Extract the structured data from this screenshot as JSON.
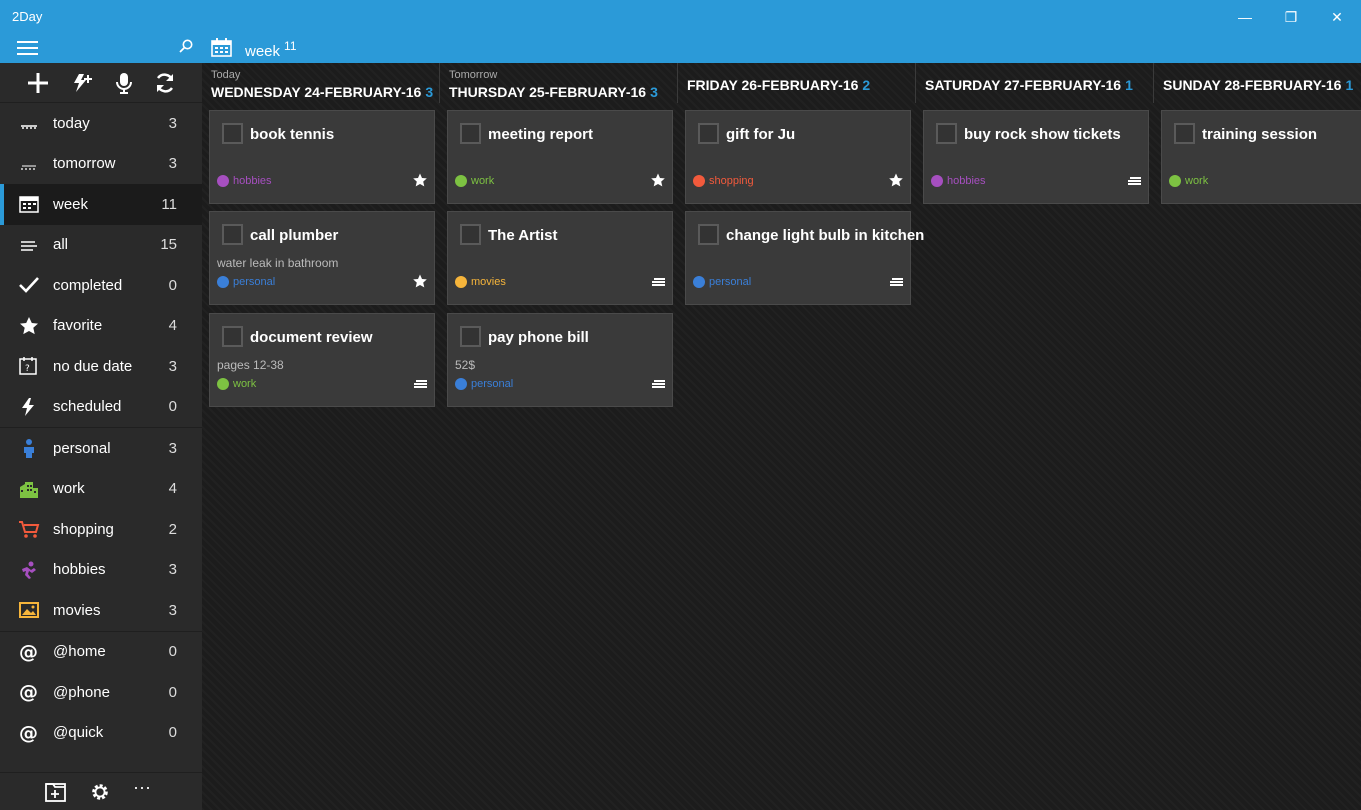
{
  "app_title": "2Day",
  "header": {
    "title": "week",
    "count": "11"
  },
  "window_controls": {
    "minimize": "—",
    "maximize": "❐",
    "close": "✕"
  },
  "colors": {
    "accent": "#2b9ad8",
    "hobbies": "#a64fc0",
    "work": "#7dc242",
    "shopping": "#f25a3c",
    "personal": "#3a7fd8",
    "movies": "#f6b53b"
  },
  "sidebar": {
    "items": [
      {
        "label": "today",
        "count": "3",
        "icon": "today-icon"
      },
      {
        "label": "tomorrow",
        "count": "3",
        "icon": "tomorrow-icon"
      },
      {
        "label": "week",
        "count": "11",
        "icon": "calendar-icon"
      },
      {
        "label": "all",
        "count": "15",
        "icon": "list-icon"
      },
      {
        "label": "completed",
        "count": "0",
        "icon": "check-icon"
      },
      {
        "label": "favorite",
        "count": "4",
        "icon": "star-icon"
      },
      {
        "label": "no due date",
        "count": "3",
        "icon": "no-date-icon"
      },
      {
        "label": "scheduled",
        "count": "0",
        "icon": "lightning-icon"
      },
      {
        "label": "personal",
        "count": "3",
        "icon": "person-icon"
      },
      {
        "label": "work",
        "count": "4",
        "icon": "building-icon"
      },
      {
        "label": "shopping",
        "count": "2",
        "icon": "cart-icon"
      },
      {
        "label": "hobbies",
        "count": "3",
        "icon": "hobbies-icon"
      },
      {
        "label": "movies",
        "count": "3",
        "icon": "picture-icon"
      },
      {
        "label": "@home",
        "count": "0",
        "icon": "at-icon"
      },
      {
        "label": "@phone",
        "count": "0",
        "icon": "at-icon"
      },
      {
        "label": "@quick",
        "count": "0",
        "icon": "at-icon"
      }
    ],
    "bottom_more": "···"
  },
  "days": [
    {
      "sub": "Today",
      "title": "WEDNESDAY 24-FEBRUARY-16",
      "count": "3"
    },
    {
      "sub": "Tomorrow",
      "title": "THURSDAY 25-FEBRUARY-16",
      "count": "3"
    },
    {
      "sub": "",
      "title": "FRIDAY 26-FEBRUARY-16",
      "count": "2"
    },
    {
      "sub": "",
      "title": "SATURDAY 27-FEBRUARY-16",
      "count": "1"
    },
    {
      "sub": "",
      "title": "SUNDAY 28-FEBRUARY-16",
      "count": "1"
    }
  ],
  "cards": [
    {
      "title": "book tennis",
      "note": "",
      "tag": "hobbies",
      "icon": "star-icon"
    },
    {
      "title": "meeting report",
      "note": "",
      "tag": "work",
      "icon": "star-icon"
    },
    {
      "title": "gift for Ju",
      "note": "",
      "tag": "shopping",
      "icon": "star-icon"
    },
    {
      "title": "buy rock show tickets",
      "note": "",
      "tag": "hobbies",
      "icon": "menu-icon"
    },
    {
      "title": "training session",
      "note": "",
      "tag": "work",
      "icon": ""
    },
    {
      "title": "call plumber",
      "note": "water leak in bathroom",
      "tag": "personal",
      "icon": "star-icon"
    },
    {
      "title": "The Artist",
      "note": "",
      "tag": "movies",
      "icon": "menu-icon"
    },
    {
      "title": "change light bulb in kitchen",
      "note": "",
      "tag": "personal",
      "icon": "menu-icon"
    },
    {
      "title": "document review",
      "note": "pages 12-38",
      "tag": "work",
      "icon": "menu-icon"
    },
    {
      "title": "pay phone bill",
      "note": "52$",
      "tag": "personal",
      "icon": "menu-icon"
    }
  ]
}
